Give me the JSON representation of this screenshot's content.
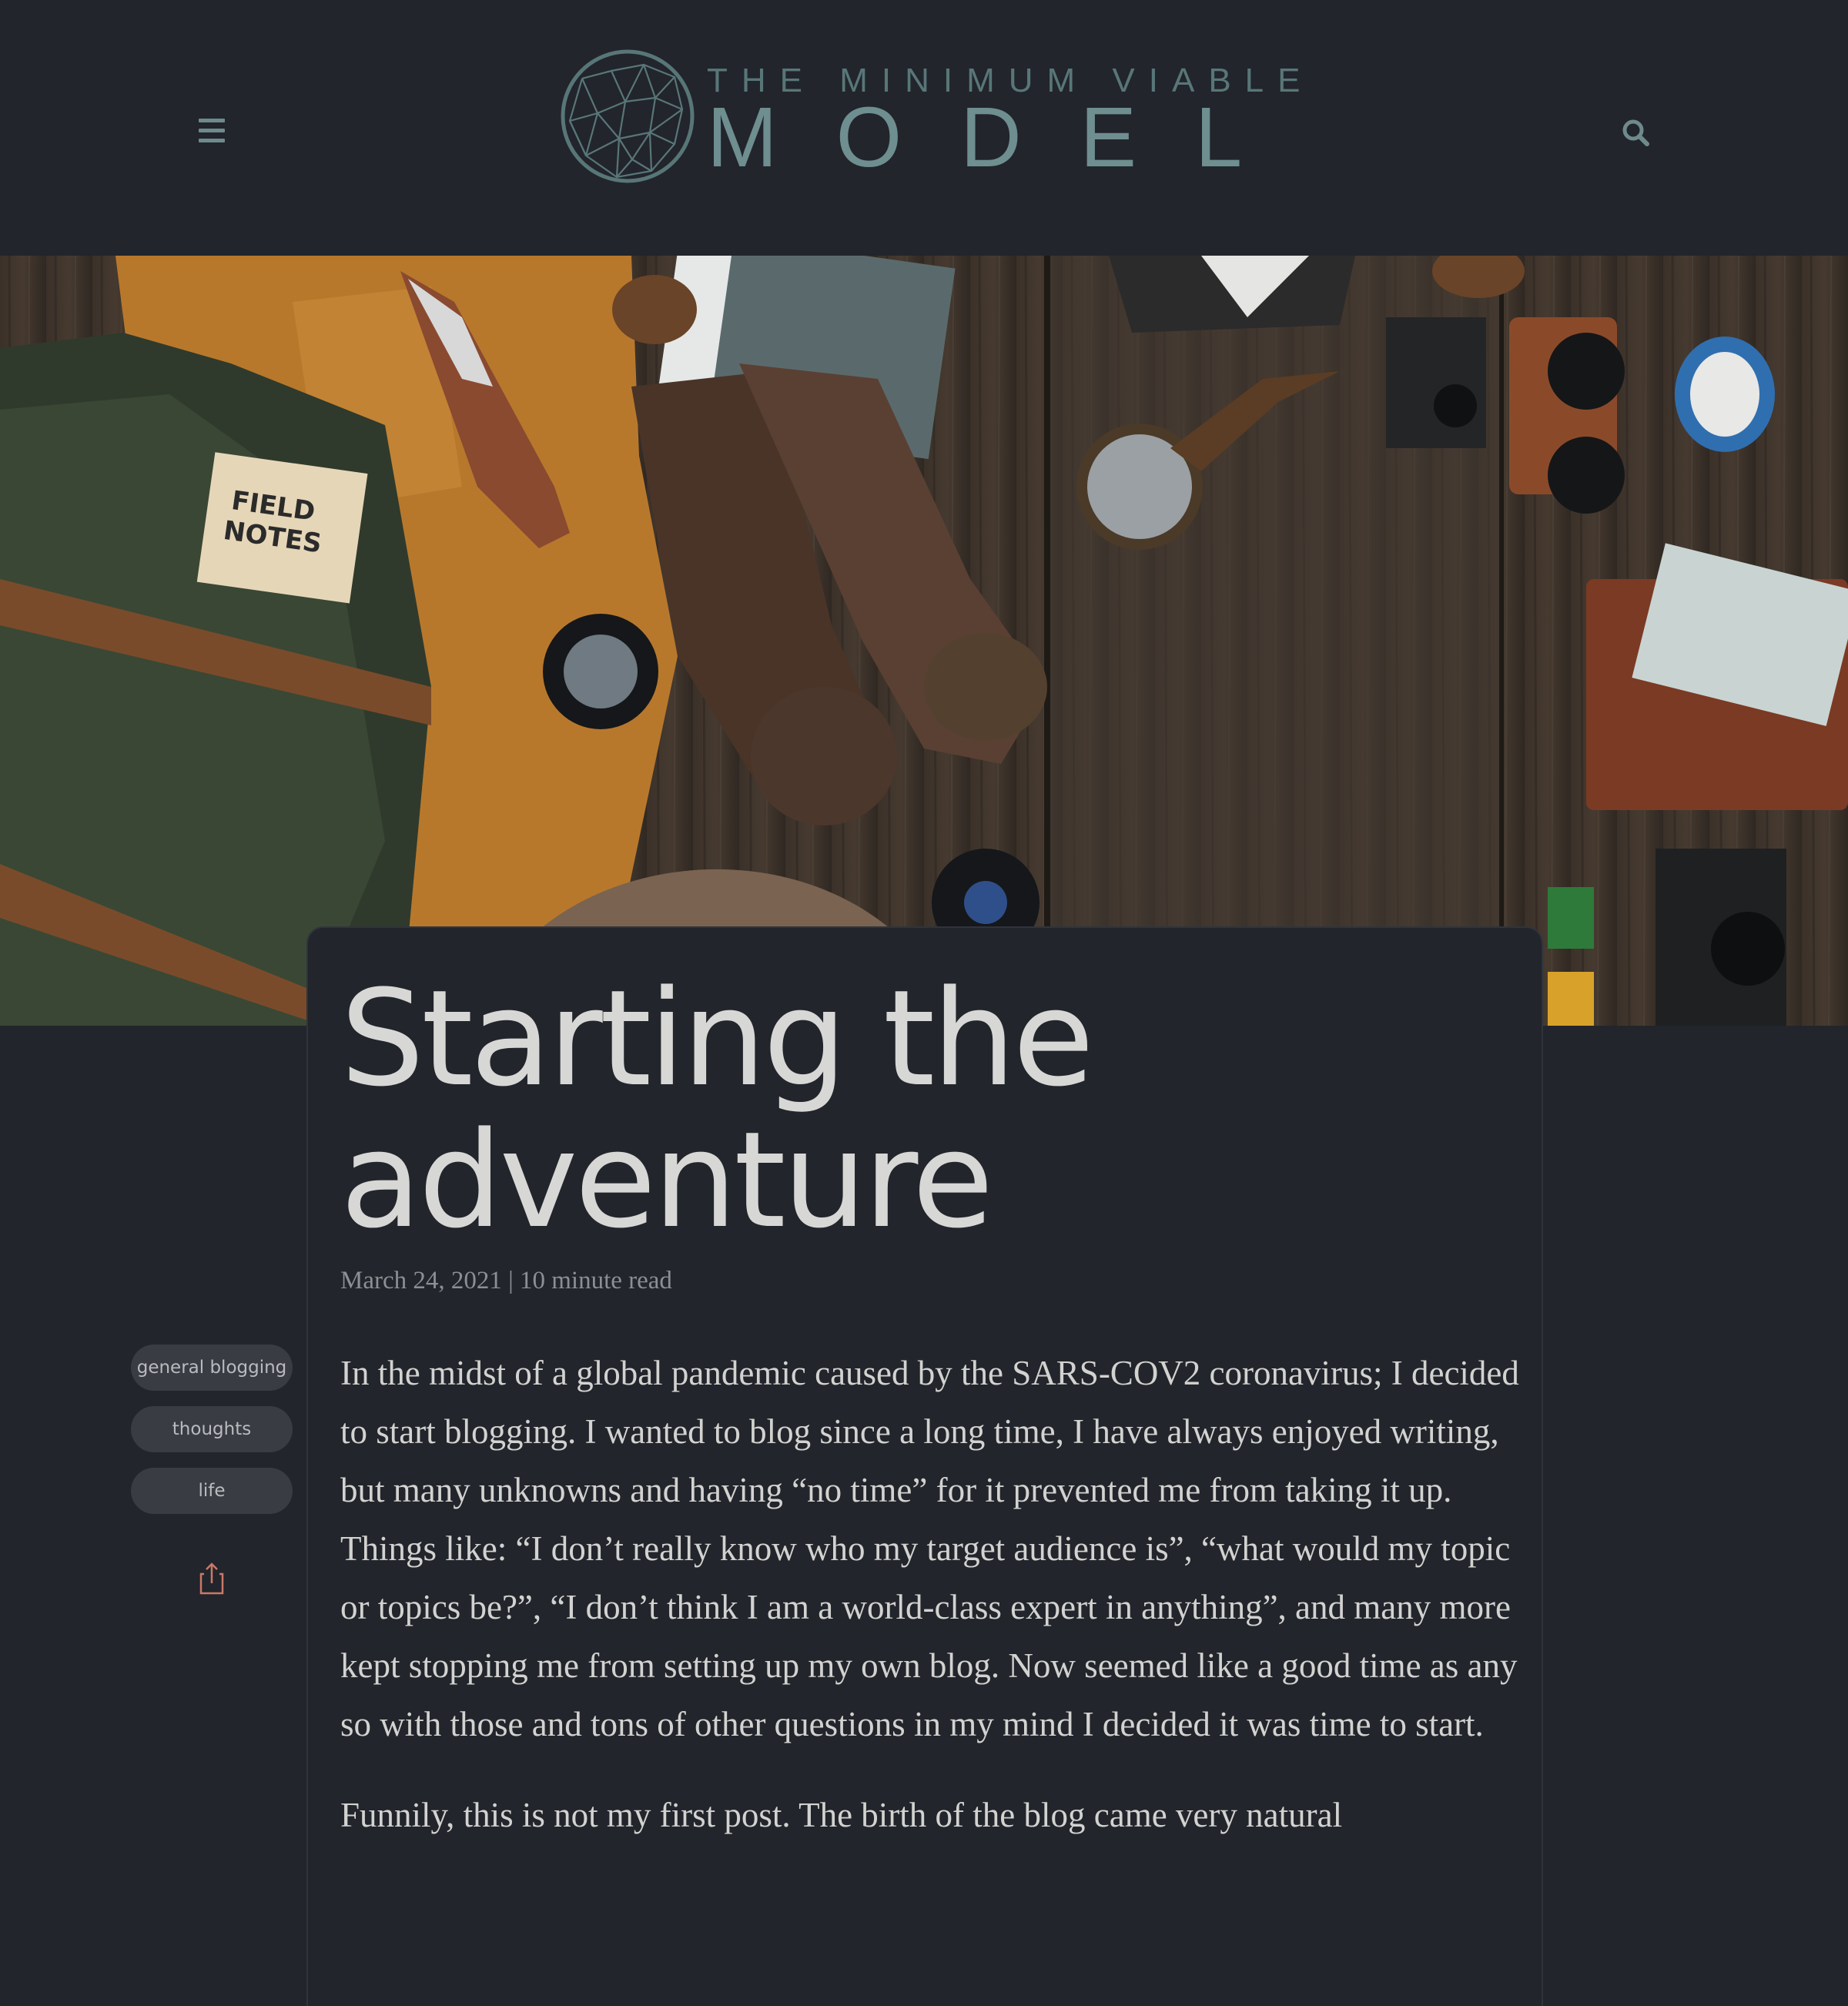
{
  "header": {
    "logo_top": "THE MINIMUM VIABLE",
    "logo_main": "MODEL",
    "menu_icon": "hamburger-menu-icon",
    "search_icon": "search-icon",
    "accent_color": "#6e8e90"
  },
  "hero": {
    "image_icon": "travel-gear-flatlay-photo",
    "notebook_label": "FIELD NOTES"
  },
  "post": {
    "title": "Starting the adventure",
    "date": "March 24, 2021",
    "separator": "|",
    "read_time": "10 minute read",
    "paragraphs": [
      "In the midst of a global pandemic caused by the SARS-COV2 coronavirus; I decided to start blogging. I wanted to blog since a long time, I have always enjoyed writing, but many unknowns and having “no time” for it prevented me from taking it up. Things like: “I don’t really know who my target audience is”, “what would my topic or topics be?”, “I don’t think I am a world-class expert in anything”, and many more kept stopping me from setting up my own blog. Now seemed like a good time as any so with those and tons of other questions in my mind I decided it was time to start.",
      "Funnily, this is not my first post. The birth of the blog came very natural"
    ]
  },
  "sidebar": {
    "tags": [
      "general blogging",
      "thoughts",
      "life"
    ],
    "share_icon": "share-icon",
    "share_color": "#c9786a"
  }
}
